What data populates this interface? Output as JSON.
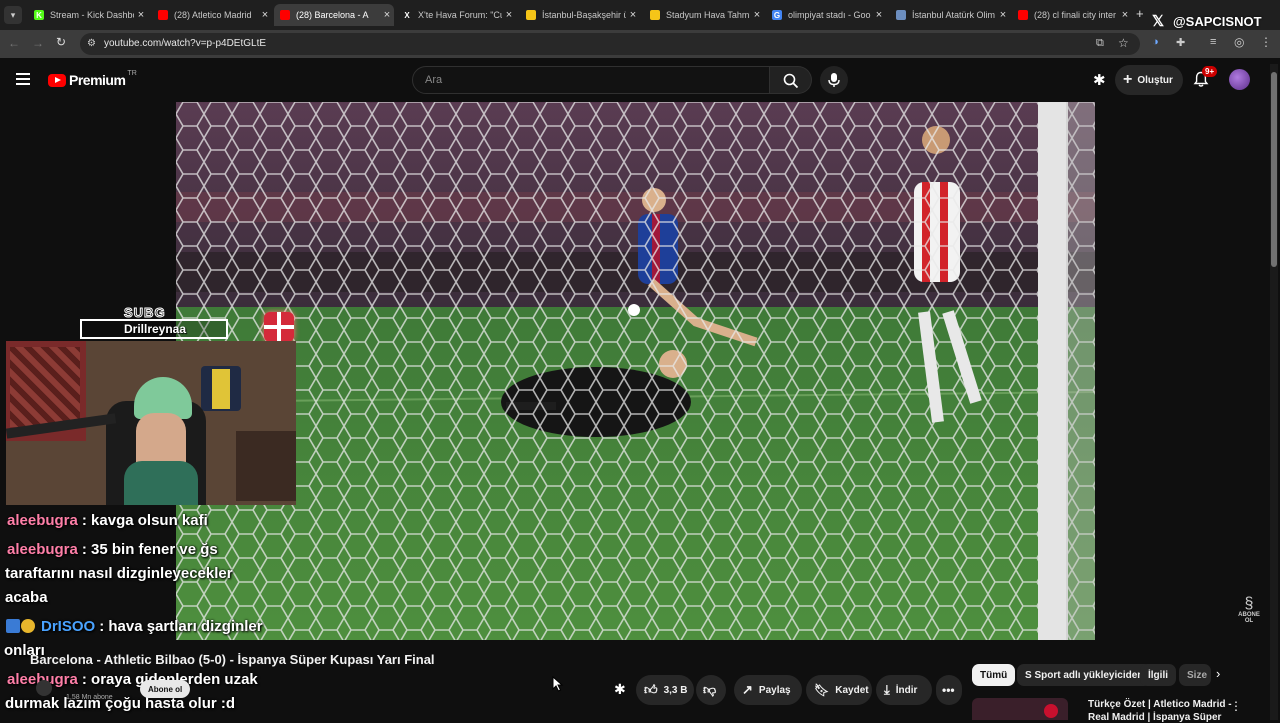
{
  "browser": {
    "tabs": [
      {
        "title": "Stream - Kick Dashbo",
        "favicon_color": "#53fc18",
        "favicon_glyph": "K"
      },
      {
        "title": "(28) Atletico Madrid",
        "favicon_color": "#ff0000",
        "favicon_glyph": ""
      },
      {
        "title": "(28) Barcelona - A",
        "favicon_color": "#ff0000",
        "favicon_glyph": "",
        "active": true
      },
      {
        "title": "X'te Hava Forum: \"Cu",
        "favicon_color": "#1f1f1f",
        "favicon_glyph": "X"
      },
      {
        "title": "İstanbul-Başakşehir ü",
        "favicon_color": "#f5c518",
        "favicon_glyph": ""
      },
      {
        "title": "Stadyum Hava Tahmi",
        "favicon_color": "#f5c518",
        "favicon_glyph": ""
      },
      {
        "title": "olimpiyat stadı - Goo",
        "favicon_color": "#4285f4",
        "favicon_glyph": "G"
      },
      {
        "title": "İstanbul Atatürk Olim",
        "favicon_color": "#6c8ebf",
        "favicon_glyph": ""
      },
      {
        "title": "(28) cl finali city inter",
        "favicon_color": "#ff0000",
        "favicon_glyph": ""
      }
    ],
    "url": "youtube.com/watch?v=p-p4DEtGLtE",
    "overlay_handle": "@SAPCISNOT"
  },
  "youtube": {
    "logo_text": "Premium",
    "logo_region": "TR",
    "search_placeholder": "Ara",
    "create_label": "Oluştur",
    "notif_count": "9+"
  },
  "stream_overlay": {
    "sub_label": "SUBG",
    "sub_name": "Drillreynaa",
    "watermark": "ABONE OL"
  },
  "chat": [
    {
      "user": "aleebugra",
      "text": ": kavga olsun kafi"
    },
    {
      "user": "aleebugra",
      "text": ": 35 bin fener ve ğs"
    },
    {
      "user": "",
      "text": "taraftarını nasıl dizginleyecekler"
    },
    {
      "user": "",
      "text": "acaba"
    },
    {
      "user": "DrISOO",
      "text": ": hava şartları dizginler"
    },
    {
      "user": "",
      "text": "onları"
    },
    {
      "user": "aleebugra",
      "text": ": oraya gidenlerden uzak"
    },
    {
      "user": "",
      "text": "durmak lazım çoğu hasta olur :d"
    }
  ],
  "video": {
    "title": "Barcelona - Athletic Bilbao (5-0) - İspanya Süper Kupası Yarı Final",
    "channel_subs": "1,58 Mn abone",
    "subscribe_label": "Abone ol",
    "likes": "3,3 B",
    "share_label": "Paylaş",
    "save_label": "Kaydet",
    "download_label": "İndir"
  },
  "related": {
    "chips": [
      "Tümü",
      "S Sport adlı yükleyiciden",
      "İlgili",
      "Size"
    ],
    "first_video_title": "Türkçe Özet | Atletico Madrid -",
    "first_video_sub": "Real Madrid | İspanya Süper"
  }
}
